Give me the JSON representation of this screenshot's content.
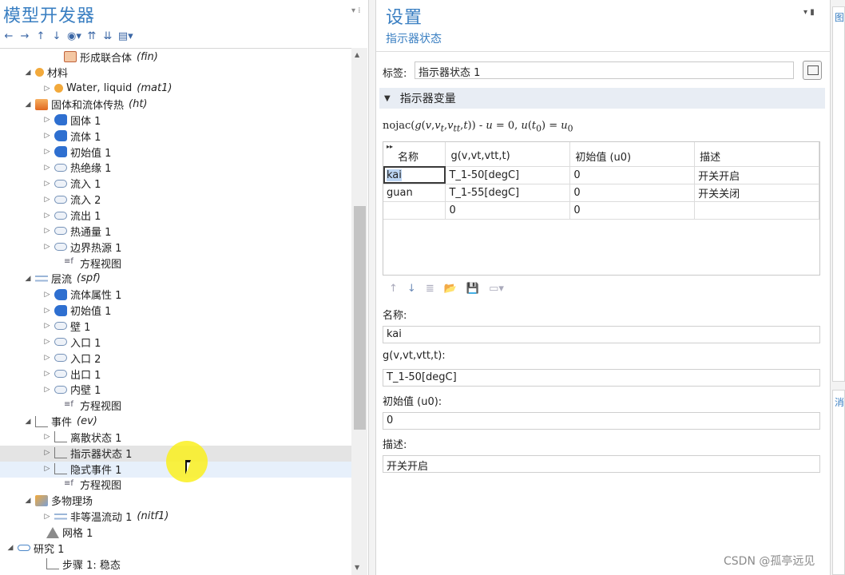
{
  "left_panel": {
    "title": "模型开发器",
    "toolbar": [
      "←",
      "→",
      "↑",
      "↓",
      "◉▾",
      "⇈",
      "⇊",
      "▤▾"
    ],
    "tree": [
      {
        "label": "形成联合体",
        "tag": "(fin)",
        "icon": "geometry-icon",
        "exp": ""
      },
      {
        "label": "材料",
        "tag": "",
        "icon": "materials-icon",
        "exp": "◢"
      },
      {
        "label": "Water, liquid",
        "tag": "(mat1)",
        "icon": "material-icon",
        "exp": "▷"
      },
      {
        "label": "固体和流体传热",
        "tag": "(ht)",
        "icon": "heat-transfer-icon",
        "exp": "◢"
      },
      {
        "label": "固体 1",
        "tag": "",
        "icon": "domain-feature-icon",
        "exp": "▷"
      },
      {
        "label": "流体 1",
        "tag": "",
        "icon": "domain-feature-icon",
        "exp": "▷"
      },
      {
        "label": "初始值 1",
        "tag": "",
        "icon": "domain-feature-icon",
        "exp": "▷"
      },
      {
        "label": "热绝缘 1",
        "tag": "",
        "icon": "boundary-feature-icon",
        "exp": "▷"
      },
      {
        "label": "流入 1",
        "tag": "",
        "icon": "boundary-feature-icon",
        "exp": "▷"
      },
      {
        "label": "流入 2",
        "tag": "",
        "icon": "boundary-feature-icon",
        "exp": "▷"
      },
      {
        "label": "流出 1",
        "tag": "",
        "icon": "boundary-feature-icon",
        "exp": "▷"
      },
      {
        "label": "热通量 1",
        "tag": "",
        "icon": "boundary-feature-icon",
        "exp": "▷"
      },
      {
        "label": "边界热源 1",
        "tag": "",
        "icon": "boundary-feature-icon",
        "exp": "▷"
      },
      {
        "label": "方程视图",
        "tag": "",
        "icon": "equation-view-icon",
        "exp": ""
      },
      {
        "label": "层流",
        "tag": "(spf)",
        "icon": "laminar-flow-icon",
        "exp": "◢"
      },
      {
        "label": "流体属性 1",
        "tag": "",
        "icon": "domain-feature-icon",
        "exp": "▷"
      },
      {
        "label": "初始值 1",
        "tag": "",
        "icon": "domain-feature-icon",
        "exp": "▷"
      },
      {
        "label": "壁 1",
        "tag": "",
        "icon": "boundary-feature-icon",
        "exp": "▷"
      },
      {
        "label": "入口 1",
        "tag": "",
        "icon": "boundary-feature-icon",
        "exp": "▷"
      },
      {
        "label": "入口 2",
        "tag": "",
        "icon": "boundary-feature-icon",
        "exp": "▷"
      },
      {
        "label": "出口 1",
        "tag": "",
        "icon": "boundary-feature-icon",
        "exp": "▷"
      },
      {
        "label": "内壁 1",
        "tag": "",
        "icon": "boundary-feature-icon",
        "exp": "▷"
      },
      {
        "label": "方程视图",
        "tag": "",
        "icon": "equation-view-icon",
        "exp": ""
      },
      {
        "label": "事件",
        "tag": "(ev)",
        "icon": "events-icon",
        "exp": "◢"
      },
      {
        "label": "离散状态 1",
        "tag": "",
        "icon": "event-feature-icon",
        "exp": "▷"
      },
      {
        "label": "指示器状态 1",
        "tag": "",
        "icon": "event-feature-icon",
        "exp": "▷"
      },
      {
        "label": "隐式事件 1",
        "tag": "",
        "icon": "event-feature-icon",
        "exp": "▷"
      },
      {
        "label": "方程视图",
        "tag": "",
        "icon": "equation-view-icon",
        "exp": ""
      },
      {
        "label": "多物理场",
        "tag": "",
        "icon": "multiphysics-icon",
        "exp": "◢"
      },
      {
        "label": "非等温流动 1",
        "tag": "(nitf1)",
        "icon": "nonisothermal-flow-icon",
        "exp": "▷"
      },
      {
        "label": "网格 1",
        "tag": "",
        "icon": "mesh-icon",
        "exp": ""
      },
      {
        "label": "研究 1",
        "tag": "",
        "icon": "study-icon",
        "exp": "◢"
      },
      {
        "label": "步骤 1: 稳态",
        "tag": "",
        "icon": "study-step-icon",
        "exp": ""
      }
    ]
  },
  "settings": {
    "title": "设置",
    "subtitle": "指示器状态",
    "label_caption": "标签:",
    "label_value": "指示器状态 1",
    "section_title": "指示器变量",
    "equation": {
      "prefix": "nojac(",
      "g": "g",
      "args_open": "(",
      "v": "v",
      "comma1": ",",
      "vt": "v",
      "vt_sub": "t",
      "comma2": ",",
      "vtt": "v",
      "vtt_sub": "tt",
      "comma3": ",",
      "t": "t",
      "args_close": "))",
      "rest1": " - ",
      "u": "u",
      "rest2": " = 0,  ",
      "u2": "u",
      "paren_open": "(",
      "t2": "t",
      "t2_sub": "0",
      "paren_close": ")",
      "eq": " = ",
      "u3": "u",
      "u3_sub": "0"
    },
    "table": {
      "headers": [
        "名称",
        "g(v,vt,vtt,t)",
        "初始值 (u0)",
        "描述"
      ],
      "rows": [
        [
          "kai",
          "T_1-50[degC]",
          "0",
          "开关开启"
        ],
        [
          "guan",
          "T_1-55[degC]",
          "0",
          "开关关闭"
        ],
        [
          "",
          "0",
          "0",
          ""
        ]
      ]
    },
    "grid_toolbar": [
      "↑",
      "↓",
      "≣",
      "📂",
      "💾",
      "▭▾"
    ],
    "fields": [
      {
        "caption": "名称:",
        "value": "kai"
      },
      {
        "caption": "g(v,vt,vtt,t):",
        "value": "T_1-50[degC]"
      },
      {
        "caption": "初始值 (u0):",
        "value": "0"
      },
      {
        "caption": "描述:",
        "value": "开关开启"
      }
    ]
  },
  "right_strip": {
    "top_label": "图",
    "bottom_label": "消"
  },
  "watermark": "CSDN @孤亭远见"
}
